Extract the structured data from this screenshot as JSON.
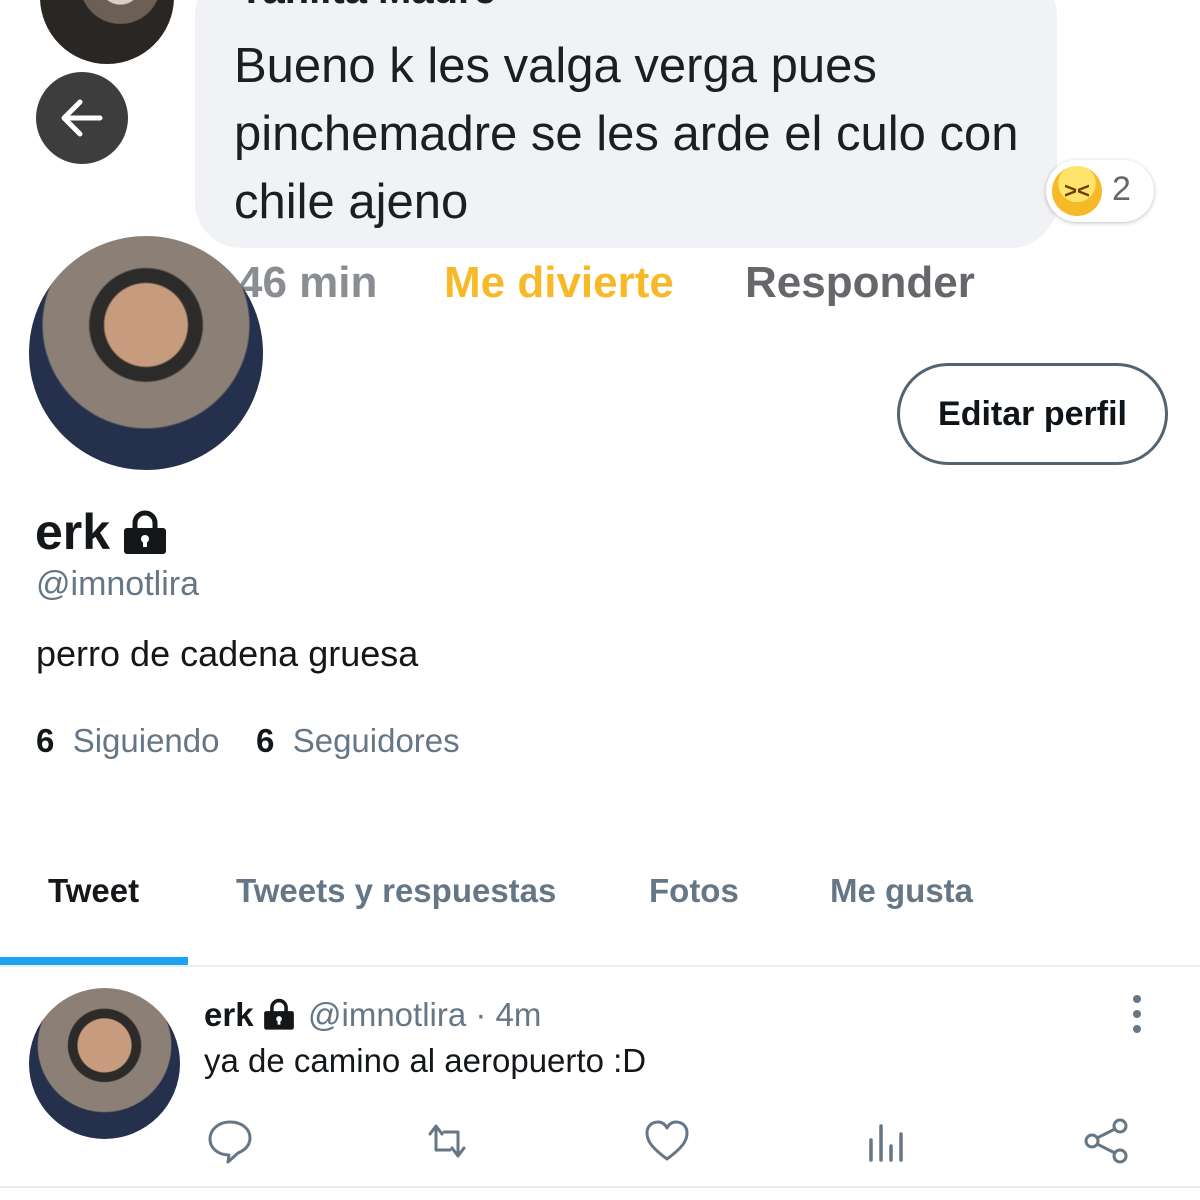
{
  "comment": {
    "author": "Yahlita Madre",
    "text": "Bueno k les valga verga pues pinchemadre se les arde el culo con chile ajeno",
    "reaction_count": "2",
    "time": "46 min",
    "reaction_label": "Me divierte",
    "reply_label": "Responder"
  },
  "profile": {
    "name": "erk",
    "handle": "@imnotlira",
    "bio": "perro de cadena gruesa",
    "edit_label": "Editar perfil",
    "following_count": "6",
    "following_label": "Siguiendo",
    "followers_count": "6",
    "followers_label": "Seguidores"
  },
  "tabs": [
    {
      "label": "Tweet",
      "active": true
    },
    {
      "label": "Tweets y respuestas",
      "active": false
    },
    {
      "label": "Fotos",
      "active": false
    },
    {
      "label": "Me gusta",
      "active": false
    }
  ],
  "tweet": {
    "name": "erk",
    "handle_time": "@imnotlira · 4m",
    "text": "ya de camino al aeropuerto :D"
  },
  "colors": {
    "accent": "#1da1f2",
    "reaction_yellow": "#f7b928",
    "muted": "#657786"
  },
  "icons": [
    "arrow-left-icon",
    "lock-icon",
    "more-vertical-icon",
    "reply-icon",
    "retweet-icon",
    "like-icon",
    "analytics-icon",
    "share-icon"
  ]
}
